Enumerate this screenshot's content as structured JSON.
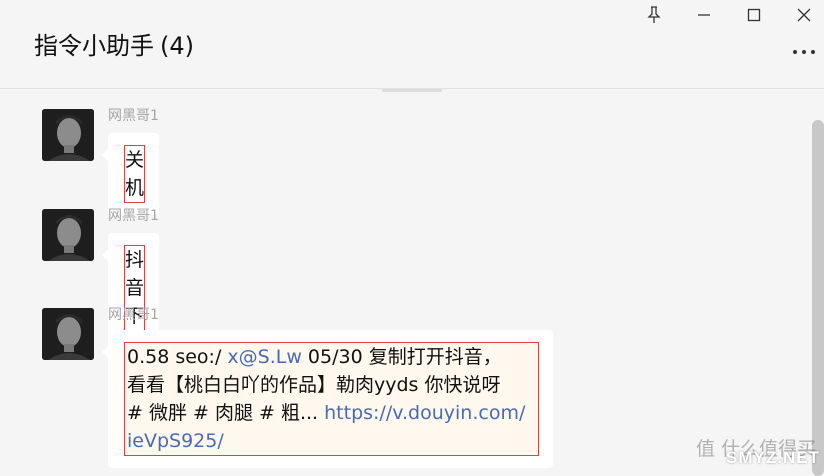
{
  "window": {
    "title": "指令小助手",
    "member_count": "(4)"
  },
  "messages": [
    {
      "sender": "网黑哥1",
      "text": "关机"
    },
    {
      "sender": "网黑哥1",
      "text": "抖音下载"
    },
    {
      "sender": "网黑哥1",
      "text_lines": {
        "l1_prefix": "0.58 seo:/ ",
        "l1_mention": "x@S.Lw",
        "l1_suffix": " 05/30 复制打开抖音，",
        "l2": "看看【桃白白吖的作品】勒肉yyds 你快说呀",
        "l3_prefix": "# 微胖 # 肉腿 # 粗... ",
        "l3_link": "https://v.douyin.com/",
        "l4_link": "ieVpS925/"
      }
    }
  ],
  "watermark": {
    "cn": "值 什么值得买",
    "en": "SMYZ.NET"
  },
  "colors": {
    "background": "#f5f5f5",
    "bubble": "#ffffff",
    "highlight_border": "#e04040",
    "link": "#4a6bb0",
    "sender": "#a4a4a4"
  },
  "icons": [
    "pin-icon",
    "minimize-icon",
    "maximize-icon",
    "close-icon",
    "more-icon",
    "avatar"
  ]
}
